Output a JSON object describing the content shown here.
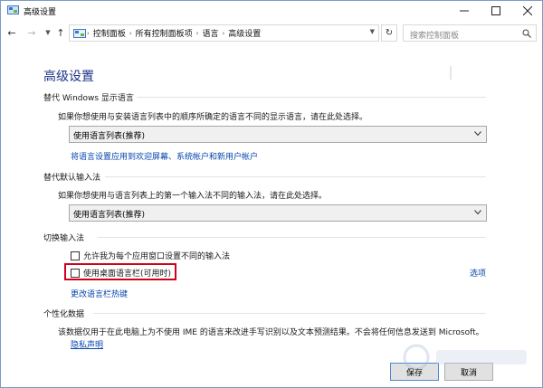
{
  "window": {
    "title": "高级设置"
  },
  "navbar": {
    "breadcrumbs": [
      "控制面板",
      "所有控制面板项",
      "语言",
      "高级设置"
    ],
    "search_placeholder": "搜索控制面板"
  },
  "page": {
    "title": "高级设置"
  },
  "display_language": {
    "heading": "替代 Windows 显示语言",
    "description": "如果你想使用与安装语言列表中的顺序所确定的语言不同的显示语言，请在此处选择。",
    "selected": "使用语言列表(推荐)",
    "apply_link": "将语言设置应用到欢迎屏幕、系统帐户和新用户帐户"
  },
  "default_input": {
    "heading": "替代默认输入法",
    "description": "如果你想使用与语言列表上的第一个输入法不同的输入法，请在此处选择。",
    "selected": "使用语言列表(推荐)"
  },
  "switch_input": {
    "heading": "切换输入法",
    "per_app_label": "允许我为每个应用窗口设置不同的输入法",
    "per_app_checked": false,
    "desktop_bar_label": "使用桌面语言栏(可用时)",
    "desktop_bar_checked": false,
    "options_link": "选项",
    "hotkeys_link": "更改语言栏热键"
  },
  "personalization": {
    "heading": "个性化数据",
    "description": "该数据仅用于在此电脑上为不使用 IME 的语言来改进手写识别以及文本预测结果。不会将任何信息发送到 Microsoft。",
    "privacy_link": "隐私声明"
  },
  "footer": {
    "save_label": "保存",
    "cancel_label": "取消"
  },
  "colors": {
    "accent_title": "#1e3287",
    "link": "#0645ad",
    "highlight": "#d0021b"
  }
}
